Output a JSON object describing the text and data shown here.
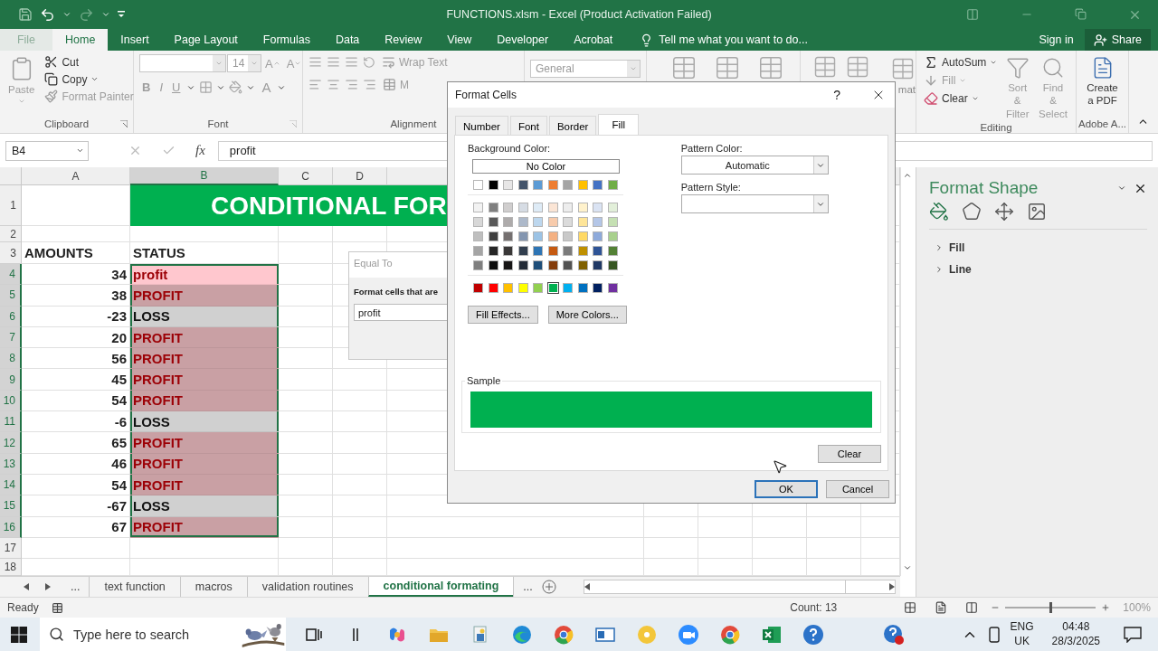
{
  "window": {
    "title": "FUNCTIONS.xlsm - Excel (Product Activation Failed)"
  },
  "ribbon_tabs": [
    {
      "label": "File",
      "selected": false
    },
    {
      "label": "Home",
      "selected": true
    },
    {
      "label": "Insert",
      "selected": false
    },
    {
      "label": "Page Layout",
      "selected": false
    },
    {
      "label": "Formulas",
      "selected": false
    },
    {
      "label": "Data",
      "selected": false
    },
    {
      "label": "Review",
      "selected": false
    },
    {
      "label": "View",
      "selected": false
    },
    {
      "label": "Developer",
      "selected": false
    },
    {
      "label": "Acrobat",
      "selected": false
    }
  ],
  "tell_me": {
    "placeholder": "Tell me what you want to do..."
  },
  "account": {
    "sign_in": "Sign in",
    "share": "Share"
  },
  "clipboard": {
    "label": "Clipboard",
    "paste": {
      "label": "Paste",
      "disabled": true
    },
    "items": [
      {
        "label": "Cut",
        "disabled": false
      },
      {
        "label": "Copy",
        "disabled": false
      },
      {
        "label": "Format Painter",
        "disabled": true
      }
    ]
  },
  "font_group": {
    "label": "Font",
    "size": "14",
    "grow": "A",
    "shrink": "A",
    "bold": "B",
    "italic": "I",
    "underline": "U",
    "font_color": "A",
    "disabled": true
  },
  "alignment_group": {
    "label": "Alignment",
    "wrap_text": "Wrap Text",
    "merge": "M",
    "disabled": true
  },
  "number_group": {
    "format": "General"
  },
  "cells_group": {
    "format": "mat"
  },
  "editing_group": {
    "label": "Editing",
    "items": [
      {
        "label": "AutoSum",
        "disabled": false
      },
      {
        "label": "Fill",
        "disabled": true
      },
      {
        "label": "Clear",
        "disabled": false
      }
    ],
    "large": [
      {
        "label": "Sort & Filter",
        "disabled": true
      },
      {
        "label": "Find & Select",
        "disabled": true
      }
    ]
  },
  "adobe_group": {
    "label": "Adobe A...",
    "create_pdf": "Create a PDF"
  },
  "formula_bar": {
    "name_box": "B4",
    "fx": "fx",
    "value": "profit"
  },
  "columns": [
    {
      "label": "A",
      "selected": false
    },
    {
      "label": "B",
      "selected": true
    },
    {
      "label": "C",
      "selected": false
    },
    {
      "label": "D",
      "selected": false
    }
  ],
  "rows": [
    {
      "number": "1",
      "kind": "banner",
      "b": "CONDITIONAL FOR"
    },
    {
      "number": "2",
      "kind": "empty"
    },
    {
      "number": "3",
      "kind": "header",
      "a": "AMOUNTS",
      "b": "STATUS"
    },
    {
      "number": "4",
      "kind": "data",
      "a": "34",
      "b": {
        "text": "profit",
        "kind": "profit"
      },
      "selected": true,
      "active": true
    },
    {
      "number": "5",
      "kind": "data",
      "a": "38",
      "b": {
        "text": "PROFIT",
        "kind": "profit"
      },
      "selected": true,
      "active": false
    },
    {
      "number": "6",
      "kind": "data",
      "a": "-23",
      "b": {
        "text": "LOSS",
        "kind": "loss"
      },
      "selected": true,
      "active": false
    },
    {
      "number": "7",
      "kind": "data",
      "a": "20",
      "b": {
        "text": "PROFIT",
        "kind": "profit"
      },
      "selected": true,
      "active": false
    },
    {
      "number": "8",
      "kind": "data",
      "a": "56",
      "b": {
        "text": "PROFIT",
        "kind": "profit"
      },
      "selected": true,
      "active": false
    },
    {
      "number": "9",
      "kind": "data",
      "a": "45",
      "b": {
        "text": "PROFIT",
        "kind": "profit"
      },
      "selected": true,
      "active": false
    },
    {
      "number": "10",
      "kind": "data",
      "a": "54",
      "b": {
        "text": "PROFIT",
        "kind": "profit"
      },
      "selected": true,
      "active": false
    },
    {
      "number": "11",
      "kind": "data",
      "a": "-6",
      "b": {
        "text": "LOSS",
        "kind": "loss"
      },
      "selected": true,
      "active": false
    },
    {
      "number": "12",
      "kind": "data",
      "a": "65",
      "b": {
        "text": "PROFIT",
        "kind": "profit"
      },
      "selected": true,
      "active": false
    },
    {
      "number": "13",
      "kind": "data",
      "a": "46",
      "b": {
        "text": "PROFIT",
        "kind": "profit"
      },
      "selected": true,
      "active": false
    },
    {
      "number": "14",
      "kind": "data",
      "a": "54",
      "b": {
        "text": "PROFIT",
        "kind": "profit"
      },
      "selected": true,
      "active": false
    },
    {
      "number": "15",
      "kind": "data",
      "a": "-67",
      "b": {
        "text": "LOSS",
        "kind": "loss"
      },
      "selected": true,
      "active": false
    },
    {
      "number": "16",
      "kind": "data",
      "a": "67",
      "b": {
        "text": "PROFIT",
        "kind": "profit"
      },
      "selected": true,
      "active": false
    },
    {
      "number": "17",
      "kind": "empty"
    },
    {
      "number": "18",
      "kind": "empty"
    }
  ],
  "equal_to_dialog": {
    "title": "Equal To",
    "prompt": "Format cells that are",
    "value": "profit"
  },
  "format_cells": {
    "title": "Format Cells",
    "help": "?",
    "tabs": [
      {
        "label": "Number",
        "selected": false
      },
      {
        "label": "Font",
        "selected": false
      },
      {
        "label": "Border",
        "selected": false
      },
      {
        "label": "Fill",
        "selected": true
      }
    ],
    "background_label": "Background Color:",
    "no_color": "No Color",
    "theme": [
      {
        "color": "#ffffff",
        "selected": false
      },
      {
        "color": "#000000",
        "selected": false
      },
      {
        "color": "#e7e6e6",
        "selected": false
      },
      {
        "color": "#44546a",
        "selected": false
      },
      {
        "color": "#5b9bd5",
        "selected": false
      },
      {
        "color": "#ed7d31",
        "selected": false
      },
      {
        "color": "#a5a5a5",
        "selected": false
      },
      {
        "color": "#ffc000",
        "selected": false
      },
      {
        "color": "#4472c4",
        "selected": false
      },
      {
        "color": "#70ad47",
        "selected": false
      }
    ],
    "tints": [
      [
        {
          "color": "#f2f2f2",
          "selected": false
        },
        {
          "color": "#7f7f7f",
          "selected": false
        },
        {
          "color": "#d0cece",
          "selected": false
        },
        {
          "color": "#d6dce4",
          "selected": false
        },
        {
          "color": "#deebf6",
          "selected": false
        },
        {
          "color": "#fbe5d5",
          "selected": false
        },
        {
          "color": "#ededed",
          "selected": false
        },
        {
          "color": "#fff2cc",
          "selected": false
        },
        {
          "color": "#dae3f3",
          "selected": false
        },
        {
          "color": "#e2efd9",
          "selected": false
        }
      ],
      [
        {
          "color": "#d8d8d8",
          "selected": false
        },
        {
          "color": "#595959",
          "selected": false
        },
        {
          "color": "#aeabab",
          "selected": false
        },
        {
          "color": "#adb9ca",
          "selected": false
        },
        {
          "color": "#bdd7ee",
          "selected": false
        },
        {
          "color": "#f7cbac",
          "selected": false
        },
        {
          "color": "#dbdbdb",
          "selected": false
        },
        {
          "color": "#fee599",
          "selected": false
        },
        {
          "color": "#b4c6e7",
          "selected": false
        },
        {
          "color": "#c5e0b3",
          "selected": false
        }
      ],
      [
        {
          "color": "#bfbfbf",
          "selected": false
        },
        {
          "color": "#3f3f3f",
          "selected": false
        },
        {
          "color": "#757070",
          "selected": false
        },
        {
          "color": "#8496b0",
          "selected": false
        },
        {
          "color": "#9cc3e5",
          "selected": false
        },
        {
          "color": "#f4b183",
          "selected": false
        },
        {
          "color": "#c9c9c9",
          "selected": false
        },
        {
          "color": "#ffd965",
          "selected": false
        },
        {
          "color": "#8eaadb",
          "selected": false
        },
        {
          "color": "#a8d08d",
          "selected": false
        }
      ],
      [
        {
          "color": "#a5a5a5",
          "selected": false
        },
        {
          "color": "#262626",
          "selected": false
        },
        {
          "color": "#3a3838",
          "selected": false
        },
        {
          "color": "#323f4f",
          "selected": false
        },
        {
          "color": "#2e75b5",
          "selected": false
        },
        {
          "color": "#c55a11",
          "selected": false
        },
        {
          "color": "#7b7b7b",
          "selected": false
        },
        {
          "color": "#bf9000",
          "selected": false
        },
        {
          "color": "#2f5496",
          "selected": false
        },
        {
          "color": "#538135",
          "selected": false
        }
      ],
      [
        {
          "color": "#7f7f7f",
          "selected": false
        },
        {
          "color": "#0c0c0c",
          "selected": false
        },
        {
          "color": "#171616",
          "selected": false
        },
        {
          "color": "#222a35",
          "selected": false
        },
        {
          "color": "#1e4e79",
          "selected": false
        },
        {
          "color": "#843c0b",
          "selected": false
        },
        {
          "color": "#525252",
          "selected": false
        },
        {
          "color": "#7f6000",
          "selected": false
        },
        {
          "color": "#1f3864",
          "selected": false
        },
        {
          "color": "#375623",
          "selected": false
        }
      ]
    ],
    "standard": [
      {
        "color": "#c00000",
        "selected": false
      },
      {
        "color": "#ff0000",
        "selected": false
      },
      {
        "color": "#ffc000",
        "selected": false
      },
      {
        "color": "#ffff00",
        "selected": false
      },
      {
        "color": "#92d050",
        "selected": false
      },
      {
        "color": "#00b050",
        "selected": true
      },
      {
        "color": "#00b0f0",
        "selected": false
      },
      {
        "color": "#0070c0",
        "selected": false
      },
      {
        "color": "#002060",
        "selected": false
      },
      {
        "color": "#7030a0",
        "selected": false
      }
    ],
    "fill_effects": "Fill Effects...",
    "more_colors": "More Colors...",
    "pattern_color_label": "Pattern Color:",
    "pattern_color": "Automatic",
    "pattern_style_label": "Pattern Style:",
    "sample_label": "Sample",
    "sample": {
      "color": "#00b050"
    },
    "clear": "Clear",
    "ok": "OK",
    "cancel": "Cancel"
  },
  "format_shape": {
    "title": "Format Shape",
    "tabs": [
      {
        "selected": true
      },
      {
        "selected": false
      },
      {
        "selected": false
      },
      {
        "selected": false
      }
    ],
    "sections": [
      {
        "label": "Fill",
        "expanded": false
      },
      {
        "label": "Line",
        "expanded": false
      }
    ]
  },
  "sheet_tabs": {
    "more_left": "...",
    "more_right": "...",
    "tabs": [
      {
        "label": "text function",
        "selected": false
      },
      {
        "label": "macros",
        "selected": false
      },
      {
        "label": "validation routines",
        "selected": false
      },
      {
        "label": "conditional formating",
        "selected": true
      }
    ]
  },
  "status_bar": {
    "ready": "Ready",
    "count": "Count: 13",
    "zoom": {
      "level": 0.5,
      "reading": "100%"
    }
  },
  "taskbar": {
    "search": {
      "placeholder": "Type here to search"
    },
    "language": "ENG",
    "region": "UK",
    "time": "04:48",
    "date": "28/3/2025"
  }
}
